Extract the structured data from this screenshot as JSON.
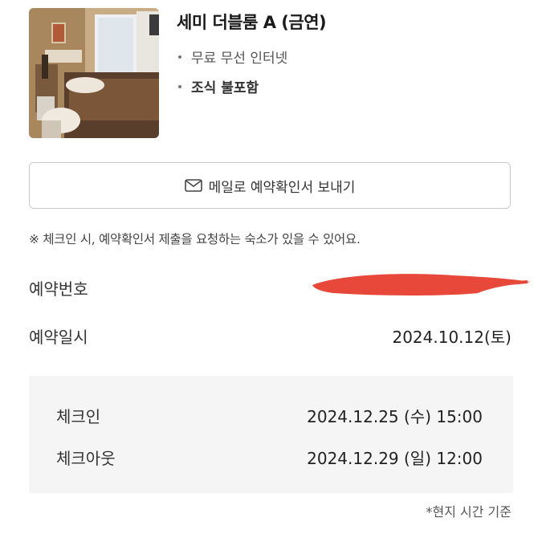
{
  "room": {
    "name": "세미 더블룸 A (금연)",
    "amenities": [
      "무료 무선 인터넷",
      "조식 불포함"
    ]
  },
  "email_button": {
    "label": "메일로 예약확인서 보내기",
    "icon": "mail-icon"
  },
  "notice": "※ 체크인 시, 예약확인서 제출을 요청하는 숙소가 있을 수 있어요.",
  "reservation": {
    "number_label": "예약번호",
    "date_label": "예약일시",
    "date_value": "2024.10.12(토)"
  },
  "stay": {
    "checkin_label": "체크인",
    "checkin_value": "2024.12.25 (수) 15:00",
    "checkout_label": "체크아웃",
    "checkout_value": "2024.12.29 (일) 12:00"
  },
  "timezone_note": "*현지 시간 기준",
  "colors": {
    "redaction": "#e8483a",
    "panel_bg": "#f5f5f5"
  }
}
